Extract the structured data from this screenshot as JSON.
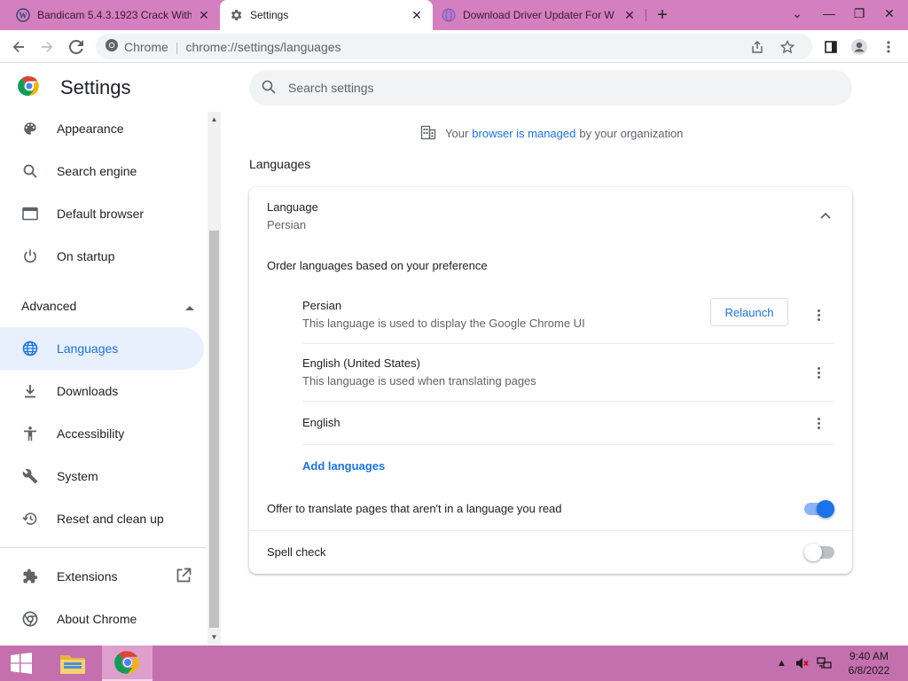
{
  "browser": {
    "tabs": [
      {
        "title": "Bandicam 5.4.3.1923 Crack With",
        "icon": "wordpress-icon",
        "active": false
      },
      {
        "title": "Settings",
        "icon": "gear-icon",
        "active": true
      },
      {
        "title": "Download Driver Updater For W",
        "icon": "globe-icon",
        "active": false
      }
    ],
    "omnibox": {
      "site": "Chrome",
      "url": "chrome://settings/languages"
    }
  },
  "settings": {
    "title": "Settings",
    "search_placeholder": "Search settings",
    "managed": {
      "prefix": "Your",
      "link": "browser is managed",
      "suffix": "by your organization"
    }
  },
  "sidebar": {
    "items": [
      {
        "label": "Appearance",
        "icon": "palette-icon"
      },
      {
        "label": "Search engine",
        "icon": "search-icon"
      },
      {
        "label": "Default browser",
        "icon": "browser-window-icon"
      },
      {
        "label": "On startup",
        "icon": "power-icon"
      }
    ],
    "advanced_label": "Advanced",
    "advanced_items": [
      {
        "label": "Languages",
        "icon": "globe-icon",
        "selected": true
      },
      {
        "label": "Downloads",
        "icon": "download-icon"
      },
      {
        "label": "Accessibility",
        "icon": "accessibility-icon"
      },
      {
        "label": "System",
        "icon": "wrench-icon"
      },
      {
        "label": "Reset and clean up",
        "icon": "history-icon"
      }
    ],
    "extensions_label": "Extensions",
    "about_label": "About Chrome"
  },
  "languages_section": {
    "title": "Languages",
    "language_label": "Language",
    "language_value": "Persian",
    "order_label": "Order languages based on your preference",
    "languages": [
      {
        "name": "Persian",
        "desc": "This language is used to display the Google Chrome UI",
        "button": "Relaunch"
      },
      {
        "name": "English (United States)",
        "desc": "This language is used when translating pages"
      },
      {
        "name": "English",
        "desc": ""
      }
    ],
    "add_languages": "Add languages",
    "offer_translate": {
      "label": "Offer to translate pages that aren't in a language you read",
      "enabled": true
    },
    "spell_check": {
      "label": "Spell check",
      "enabled": false
    }
  },
  "taskbar": {
    "time": "9:40 AM",
    "date": "6/8/2022"
  },
  "colors": {
    "accent": "#1a73e8",
    "tabstrip": "#d47fbf",
    "taskbar": "#c46fae"
  }
}
